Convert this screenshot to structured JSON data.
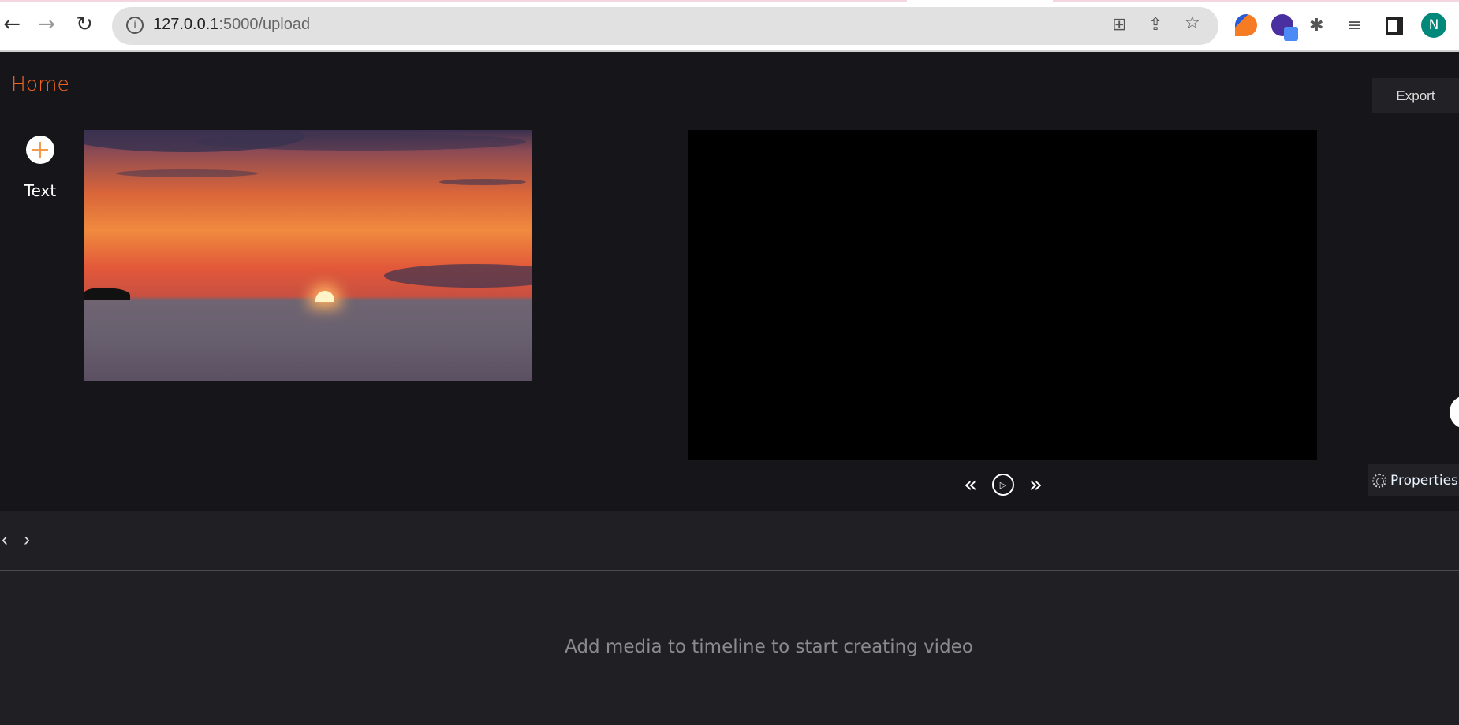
{
  "browser": {
    "url_host": "127.0.0.1",
    "url_rest": ":5000/upload",
    "avatar_letter": "N"
  },
  "app": {
    "home_label": "Home",
    "export_label": "Export",
    "tools": [
      {
        "label": "Text",
        "icon": "plus-circle-icon"
      }
    ],
    "properties_label": "Properties",
    "timeline_empty": "Add media to timeline to start creating video",
    "accent": "#f0661e"
  }
}
